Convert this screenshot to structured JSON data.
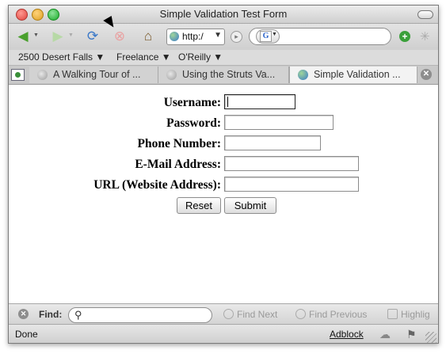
{
  "window": {
    "title": "Simple Validation Test Form",
    "traffic_light_colors": [
      "#e0443e",
      "#dea123",
      "#1aab29"
    ]
  },
  "navbar": {
    "back_icon": "arrow-left-icon",
    "forward_icon": "arrow-right-icon",
    "reload_icon": "reload-icon",
    "stop_icon": "stop-icon",
    "home_icon": "home-icon",
    "address_value": "http:/",
    "search_engine_letter": "G",
    "search_value": ""
  },
  "bookmarks": [
    {
      "label": "2500 Desert Falls ▼"
    },
    {
      "label": "Freelance ▼"
    },
    {
      "label": "O'Reilly ▼"
    }
  ],
  "tabs": [
    {
      "label": "A Walking Tour of ...",
      "active": false
    },
    {
      "label": "Using the Struts Va...",
      "active": false
    },
    {
      "label": "Simple Validation ...",
      "active": true
    }
  ],
  "form": {
    "fields": [
      {
        "label": "Username:",
        "value": ""
      },
      {
        "label": "Password:",
        "value": ""
      },
      {
        "label": "Phone Number:",
        "value": ""
      },
      {
        "label": "E-Mail Address:",
        "value": ""
      },
      {
        "label": "URL (Website Address):",
        "value": ""
      }
    ],
    "reset_label": "Reset",
    "submit_label": "Submit"
  },
  "findbar": {
    "label": "Find:",
    "value": "",
    "find_next": "Find Next",
    "find_previous": "Find Previous",
    "highlight": "Highlig"
  },
  "statusbar": {
    "status": "Done",
    "adblock": "Adblock"
  },
  "colors": {
    "accent_green": "#3aa03a"
  }
}
